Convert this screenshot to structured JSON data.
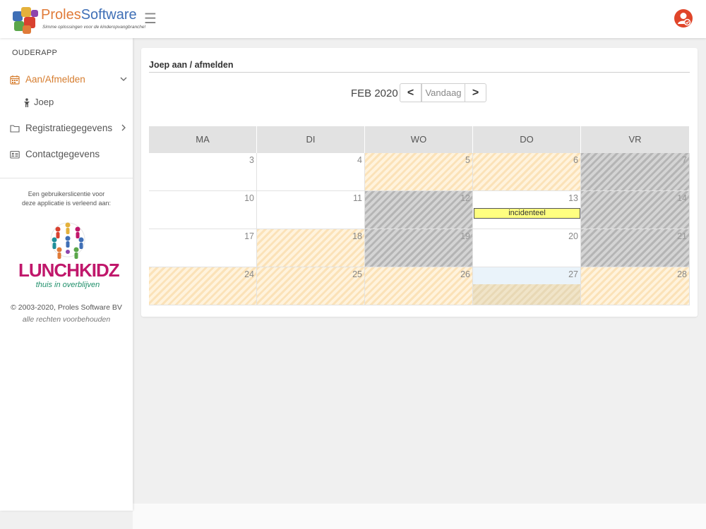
{
  "header": {
    "logo": {
      "name_part1": "Proles",
      "name_part2": "Software",
      "tagline": "Simme oplossingen voor de kinderopvangbranche!"
    },
    "menu_icon": "hamburger-icon",
    "user_icon": "user-account-icon"
  },
  "sidebar": {
    "heading": "OUDERAPP",
    "items": [
      {
        "label": "Aan/Afmelden",
        "icon": "calendar-icon",
        "active": true
      },
      {
        "label": "Registratiegegevens",
        "icon": "folder-icon"
      },
      {
        "label": "Contactgegevens",
        "icon": "contact-card-icon"
      }
    ],
    "subitems": [
      {
        "label": "Joep",
        "icon": "child-icon"
      }
    ],
    "license_line1": "Een gebruikerslicentie voor",
    "license_line2": "deze applicatie is verleend aan:",
    "partner_logo": {
      "title": "LUNCHKIDZ",
      "subtitle": "thuis in overblijven"
    },
    "copyright": "© 2003-2020, Proles Software BV",
    "rights": "alle rechten voorbehouden"
  },
  "main": {
    "title": "Joep aan / afmelden",
    "calendar": {
      "month_label": "FEB 2020",
      "prev_label": "<",
      "today_label": "Vandaag",
      "next_label": ">",
      "days": [
        "MA",
        "DI",
        "WO",
        "DO",
        "VR"
      ],
      "weeks": [
        [
          {
            "n": "3",
            "s": "plain"
          },
          {
            "n": "4",
            "s": "plain"
          },
          {
            "n": "5",
            "s": "orange"
          },
          {
            "n": "6",
            "s": "orange"
          },
          {
            "n": "7",
            "s": "gray"
          }
        ],
        [
          {
            "n": "10",
            "s": "plain"
          },
          {
            "n": "11",
            "s": "plain"
          },
          {
            "n": "12",
            "s": "gray"
          },
          {
            "n": "13",
            "s": "plain",
            "event": "incidenteel"
          },
          {
            "n": "14",
            "s": "gray"
          }
        ],
        [
          {
            "n": "17",
            "s": "plain"
          },
          {
            "n": "18",
            "s": "orange"
          },
          {
            "n": "19",
            "s": "gray"
          },
          {
            "n": "20",
            "s": "plain"
          },
          {
            "n": "21",
            "s": "gray"
          }
        ],
        [
          {
            "n": "24",
            "s": "orange"
          },
          {
            "n": "25",
            "s": "orange"
          },
          {
            "n": "26",
            "s": "orange"
          },
          {
            "n": "27",
            "s": "today"
          },
          {
            "n": "28",
            "s": "orange"
          }
        ]
      ]
    }
  },
  "colors": {
    "accent": "#d67d2f",
    "event_bg": "#ffff80",
    "partner_pink": "#c0176b"
  }
}
